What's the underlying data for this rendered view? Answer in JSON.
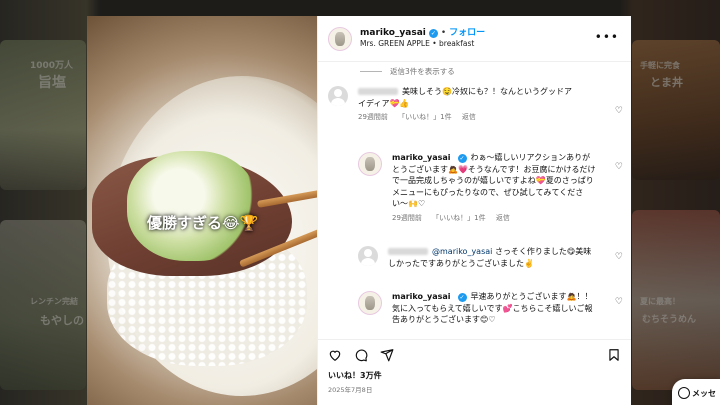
{
  "background": {
    "left_text_1": "1000万人",
    "left_text_2": "旨塩",
    "left_text_3": "レンチン完結",
    "left_text_4": "もやしの",
    "right_text_1": "手軽に完食",
    "right_text_2": "とま丼",
    "right_text_3": "夏に最高！",
    "right_text_4": "むちそうめん"
  },
  "post": {
    "username": "mariko_yasai",
    "follow_label": "フォロー",
    "subtitle": "Mrs. GREEN APPLE • breakfast",
    "media_caption": "優勝すぎる😂🏆",
    "likes": "いいね！3万件",
    "date": "2025年7月8日"
  },
  "comments": {
    "view_replies": "返信3件を表示する",
    "items": [
      {
        "text": "美味しそう🤤冷奴にも？！なんというグッドアイディア💝👍",
        "time": "29週間前",
        "likes": "「いいね！」1件",
        "reply": "返信"
      },
      {
        "user": "mariko_yasai",
        "text": "わぁ〜嬉しいリアクションありがとうございます🙇💗そうなんです！お豆腐にかけるだけで一品完成しちゃうのが嬉しいですよね💝夏のさっぱりメニューにもぴったりなので、ぜひ試してみてください〜🙌♡",
        "time": "29週間前",
        "likes": "「いいね！」1件",
        "reply": "返信"
      },
      {
        "mention": "@mariko_yasai",
        "text": "さっそく作りました😋美味しかったですありがとうございました✌️",
        "time": "",
        "likes": "",
        "reply": ""
      },
      {
        "user": "mariko_yasai",
        "text": "早速ありがとうございます🙇！！気に入ってもらえて嬉しいです💕こちらこそ嬉しいご報告ありがとうございます😊♡",
        "time": "",
        "likes": "",
        "reply": ""
      }
    ]
  },
  "ui": {
    "messages_label": "メッセ"
  }
}
